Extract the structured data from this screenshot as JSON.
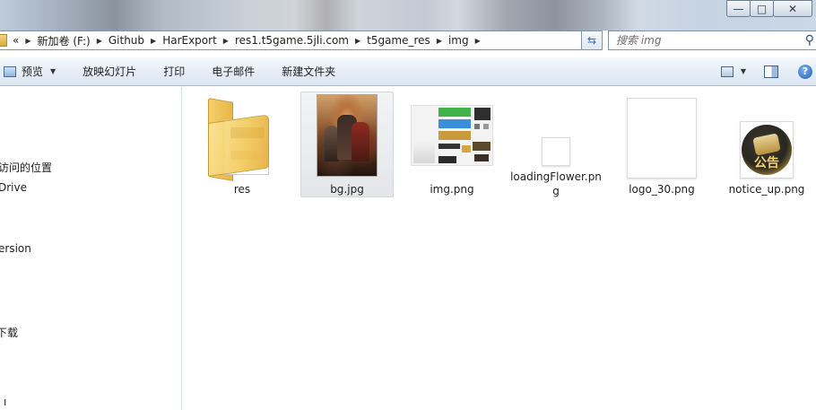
{
  "window": {
    "controls": {
      "minimize": "—",
      "maximize": "□",
      "close": "✕"
    }
  },
  "address": {
    "overflow": "«",
    "crumbs": [
      "新加卷 (F:)",
      "Github",
      "HarExport",
      "res1.t5game.5jli.com",
      "t5game_res",
      "img"
    ]
  },
  "search": {
    "placeholder": "搜索 img"
  },
  "toolbar": {
    "preview": "预览",
    "slideshow": "放映幻灯片",
    "print": "打印",
    "email": "电子邮件",
    "new_folder": "新建文件夹",
    "help": "?"
  },
  "nav": {
    "items": [
      "访问的位置",
      "Drive",
      "ersion",
      "下载",
      "ı"
    ]
  },
  "files": [
    {
      "name": "res",
      "kind": "folder"
    },
    {
      "name": "bg.jpg",
      "kind": "image",
      "selected": true
    },
    {
      "name": "img.png",
      "kind": "image"
    },
    {
      "name": "loadingFlower.png",
      "kind": "image"
    },
    {
      "name": "logo_30.png",
      "kind": "image"
    },
    {
      "name": "notice_up.png",
      "kind": "image"
    }
  ],
  "thumb_text": {
    "notice_caption": "公告"
  },
  "colors": {
    "selection": "#e4e6e9",
    "toolbar_top": "#f5f9fd",
    "toolbar_bottom": "#dae6f2",
    "folder_yellow": "#f3c95a"
  }
}
